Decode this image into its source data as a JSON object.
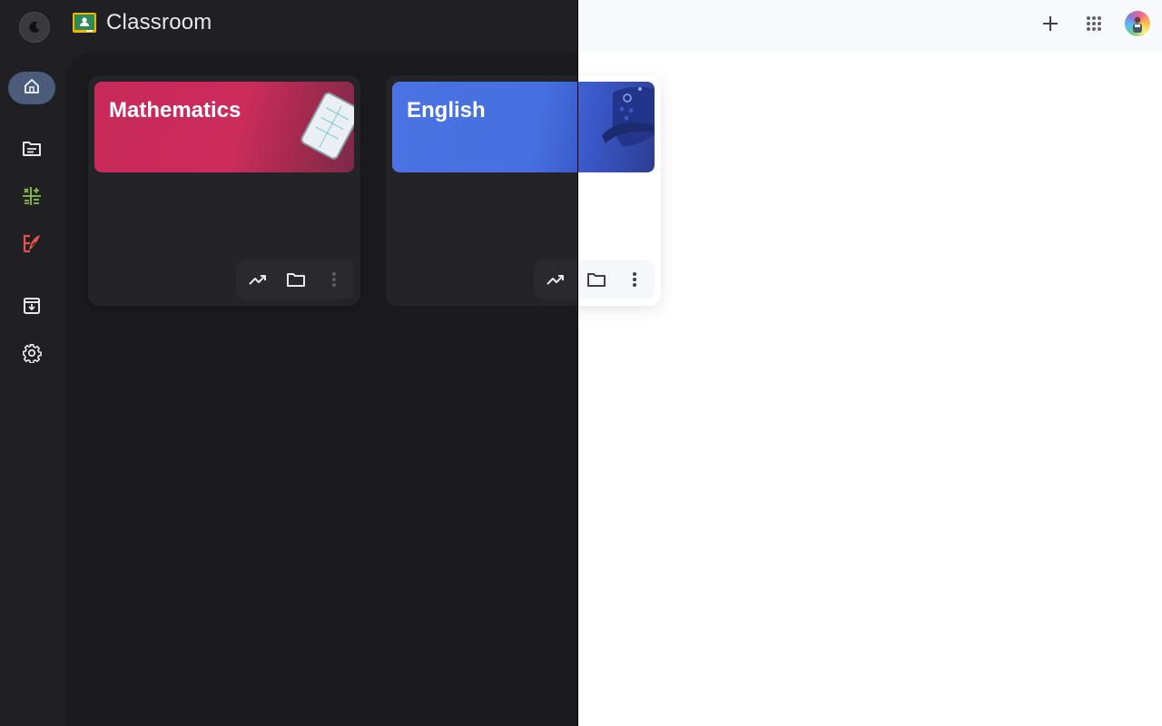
{
  "app": {
    "title": "Classroom"
  },
  "theme": {
    "dark_background": "#1f1f24",
    "light_background": "#ffffff",
    "rail_active": "#4b5b7a"
  },
  "topbar": {
    "theme_toggle_icon": "moon-icon",
    "logo_icon": "classroom-logo-icon",
    "right_icons": [
      "add-icon",
      "apps-grid-icon",
      "avatar"
    ]
  },
  "rail": {
    "items": [
      {
        "icon": "home-icon",
        "active": true
      },
      {
        "icon": "class-list-icon",
        "active": false
      },
      {
        "icon": "math-class-icon",
        "color": "#8bc34a",
        "active": false
      },
      {
        "icon": "english-class-icon",
        "color": "#e5534b",
        "active": false
      },
      {
        "icon": "archive-icon",
        "active": false
      },
      {
        "icon": "settings-icon",
        "active": false
      }
    ]
  },
  "classes": [
    {
      "name": "Mathematics",
      "banner_color": "#c7295a",
      "actions": [
        "trending-up-icon",
        "folder-icon",
        "more-vert-icon"
      ]
    },
    {
      "name": "English",
      "banner_color": "#4a72e2",
      "actions": [
        "trending-up-icon",
        "folder-icon",
        "more-vert-icon"
      ]
    }
  ]
}
